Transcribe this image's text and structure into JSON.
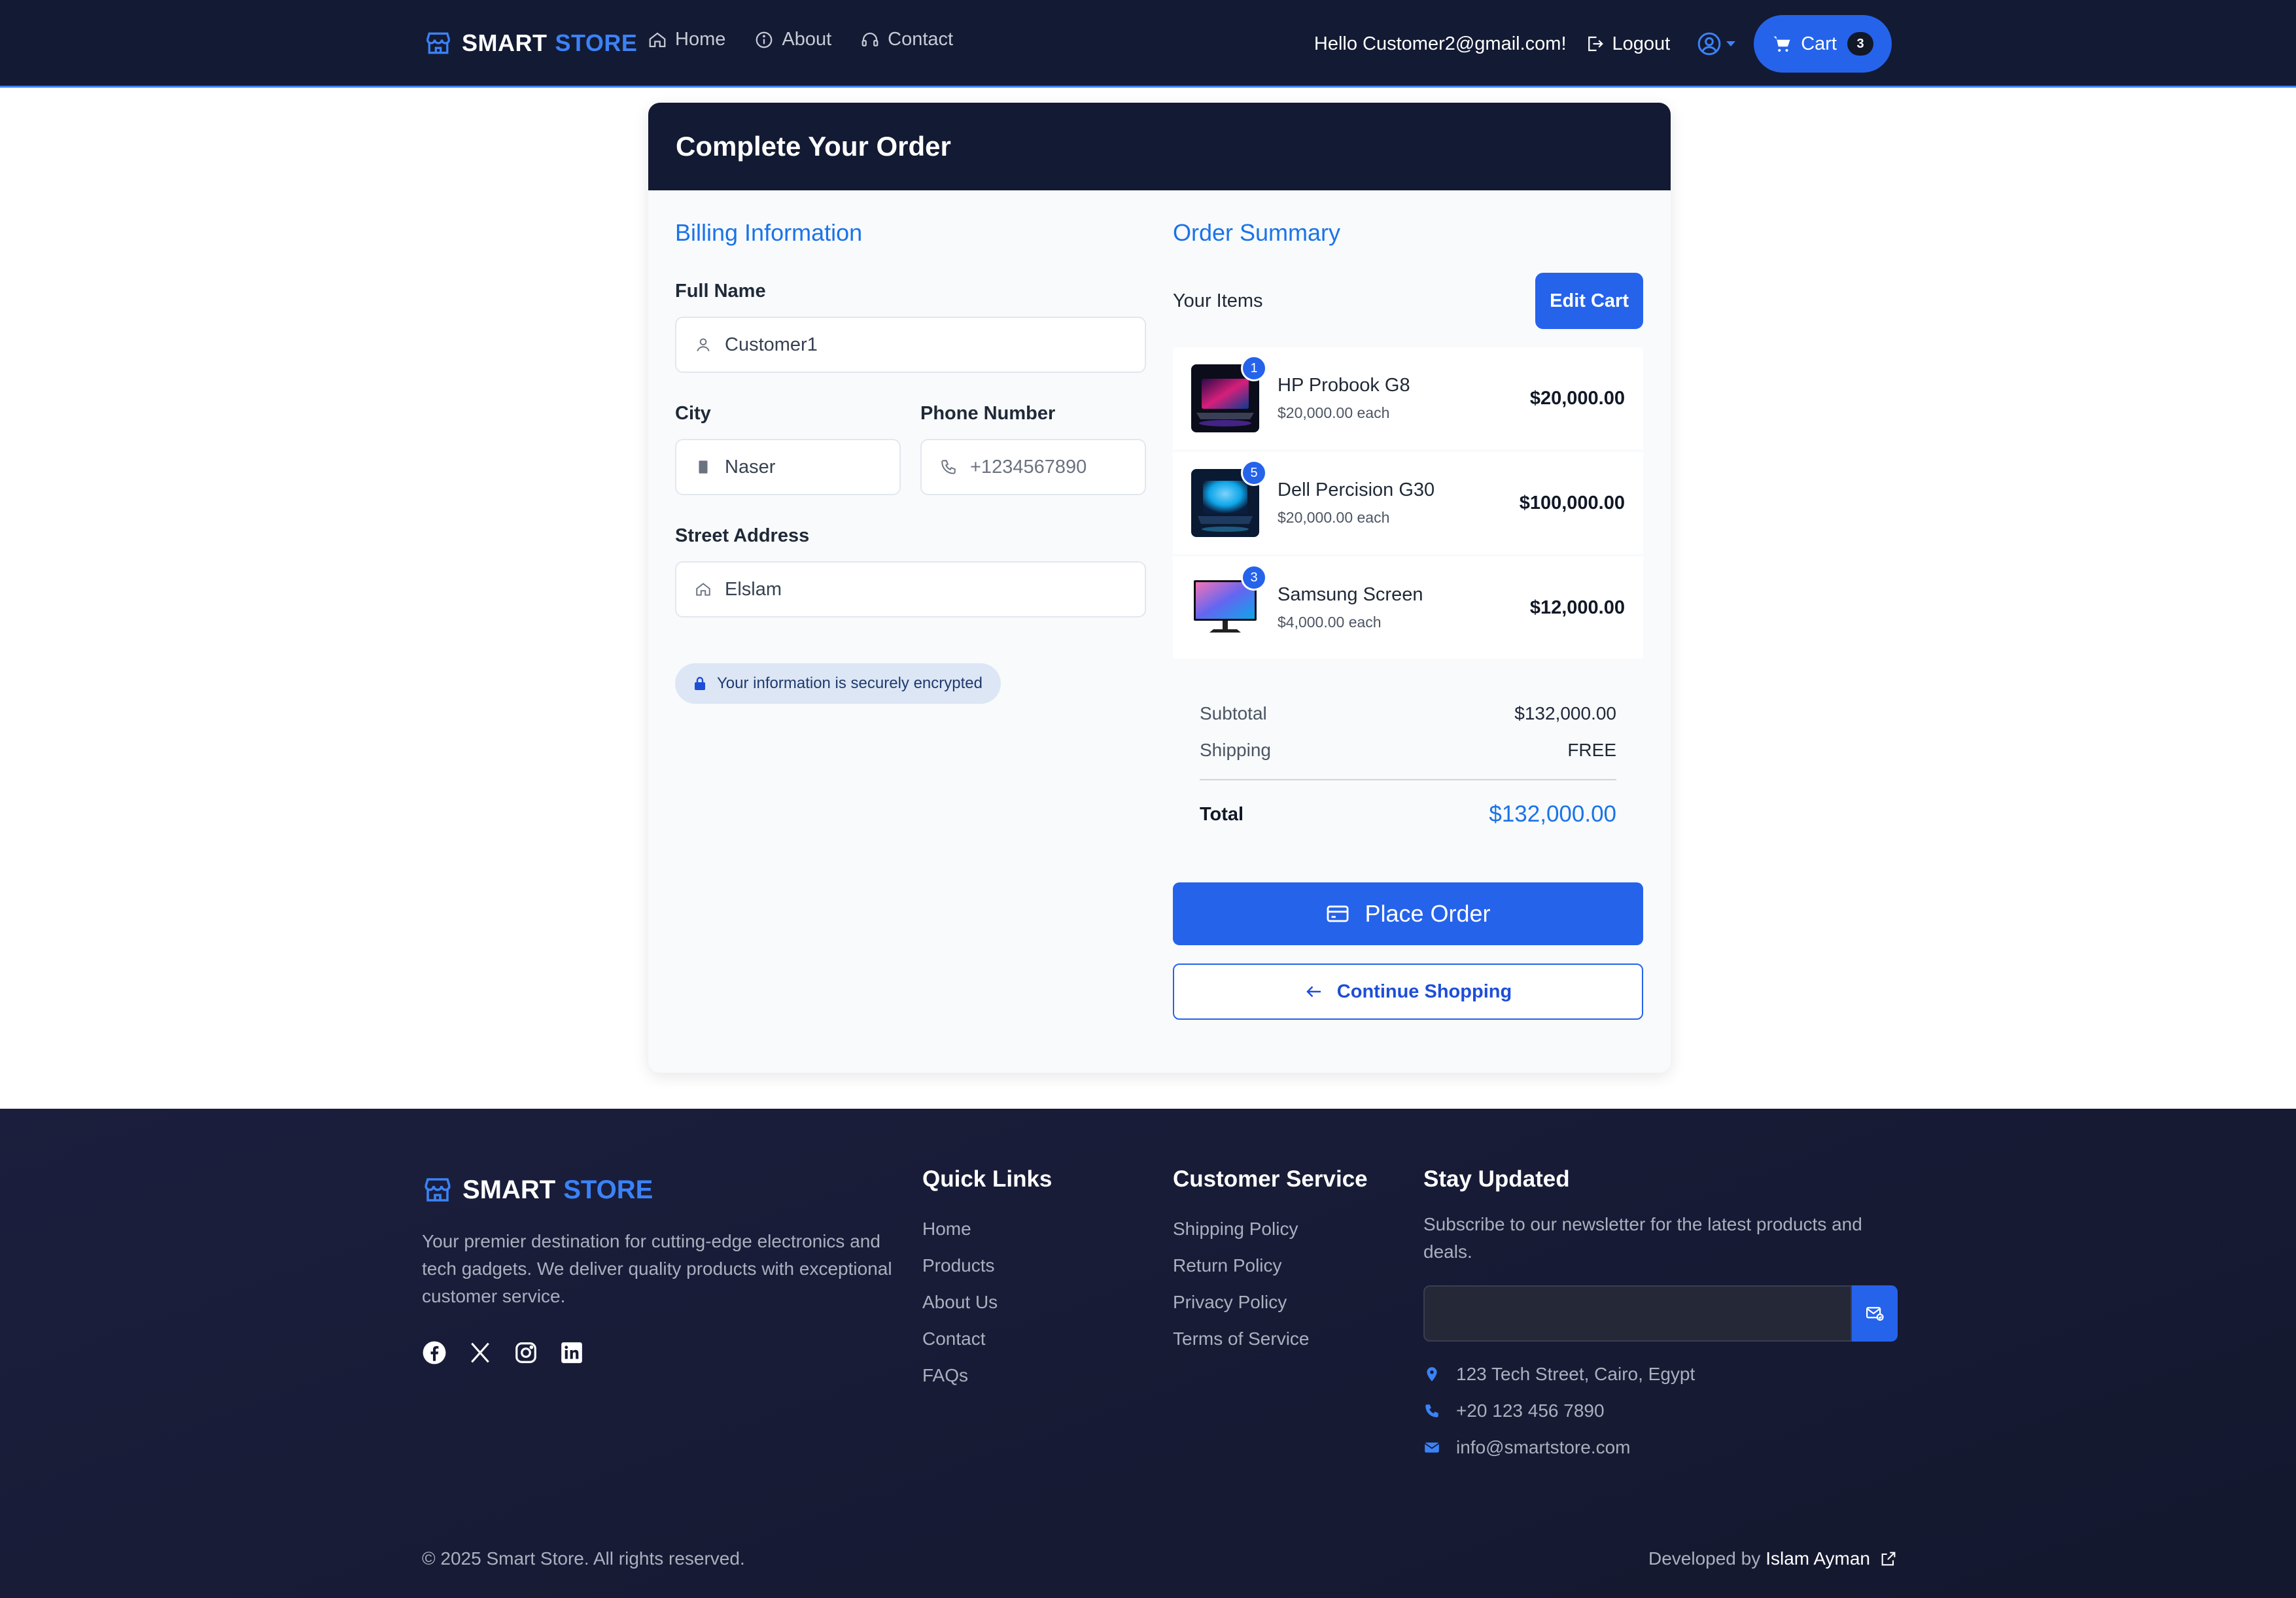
{
  "brand": {
    "part1": "SMART",
    "part2": "STORE"
  },
  "nav": {
    "links": [
      {
        "label": "Home",
        "icon": "home-icon"
      },
      {
        "label": "About",
        "icon": "info-icon"
      },
      {
        "label": "Contact",
        "icon": "headset-icon"
      }
    ],
    "greeting": "Hello Customer2@gmail.com!",
    "logout": "Logout",
    "cart_label": "Cart",
    "cart_count": "3"
  },
  "page": {
    "title": "Complete Your Order"
  },
  "billing": {
    "title": "Billing Information",
    "full_name_label": "Full Name",
    "full_name_value": "Customer1",
    "city_label": "City",
    "city_value": "Naser",
    "phone_label": "Phone Number",
    "phone_placeholder": "+1234567890",
    "street_label": "Street Address",
    "street_value": "Elslam",
    "secure_note": "Your information is securely encrypted"
  },
  "summary": {
    "title": "Order Summary",
    "items_label": "Your Items",
    "edit_cart": "Edit Cart",
    "items": [
      {
        "name": "HP Probook G8",
        "each": "$20,000.00 each",
        "total": "$20,000.00",
        "qty": "1",
        "thumb": "laptop"
      },
      {
        "name": "Dell Percision G30",
        "each": "$20,000.00 each",
        "total": "$100,000.00",
        "qty": "5",
        "thumb": "laptop-blue"
      },
      {
        "name": "Samsung Screen",
        "each": "$4,000.00 each",
        "total": "$12,000.00",
        "qty": "3",
        "thumb": "monitor"
      }
    ],
    "subtotal_label": "Subtotal",
    "subtotal_value": "$132,000.00",
    "shipping_label": "Shipping",
    "shipping_value": "FREE",
    "total_label": "Total",
    "total_value": "$132,000.00",
    "place_order": "Place Order",
    "continue_shopping": "Continue Shopping"
  },
  "footer": {
    "description": "Your premier destination for cutting-edge electronics and tech gadgets. We deliver quality products with exceptional customer service.",
    "social": [
      "facebook-icon",
      "x-icon",
      "instagram-icon",
      "linkedin-icon"
    ],
    "quick_links_title": "Quick Links",
    "quick_links": [
      "Home",
      "Products",
      "About Us",
      "Contact",
      "FAQs"
    ],
    "service_title": "Customer Service",
    "service_links": [
      "Shipping Policy",
      "Return Policy",
      "Privacy Policy",
      "Terms of Service"
    ],
    "newsletter_title": "Stay Updated",
    "newsletter_text": "Subscribe to our newsletter for the latest products and deals.",
    "newsletter_placeholder": "",
    "address": "123 Tech Street, Cairo, Egypt",
    "phone": "+20 123 456 7890",
    "email": "info@smartstore.com",
    "copyright": "© 2025 Smart Store. All rights reserved.",
    "developed_by": "Developed by",
    "developer": "Islam Ayman"
  },
  "colors": {
    "navy": "#131a33",
    "accent": "#2563eb",
    "link_blue": "#1a73e8"
  }
}
